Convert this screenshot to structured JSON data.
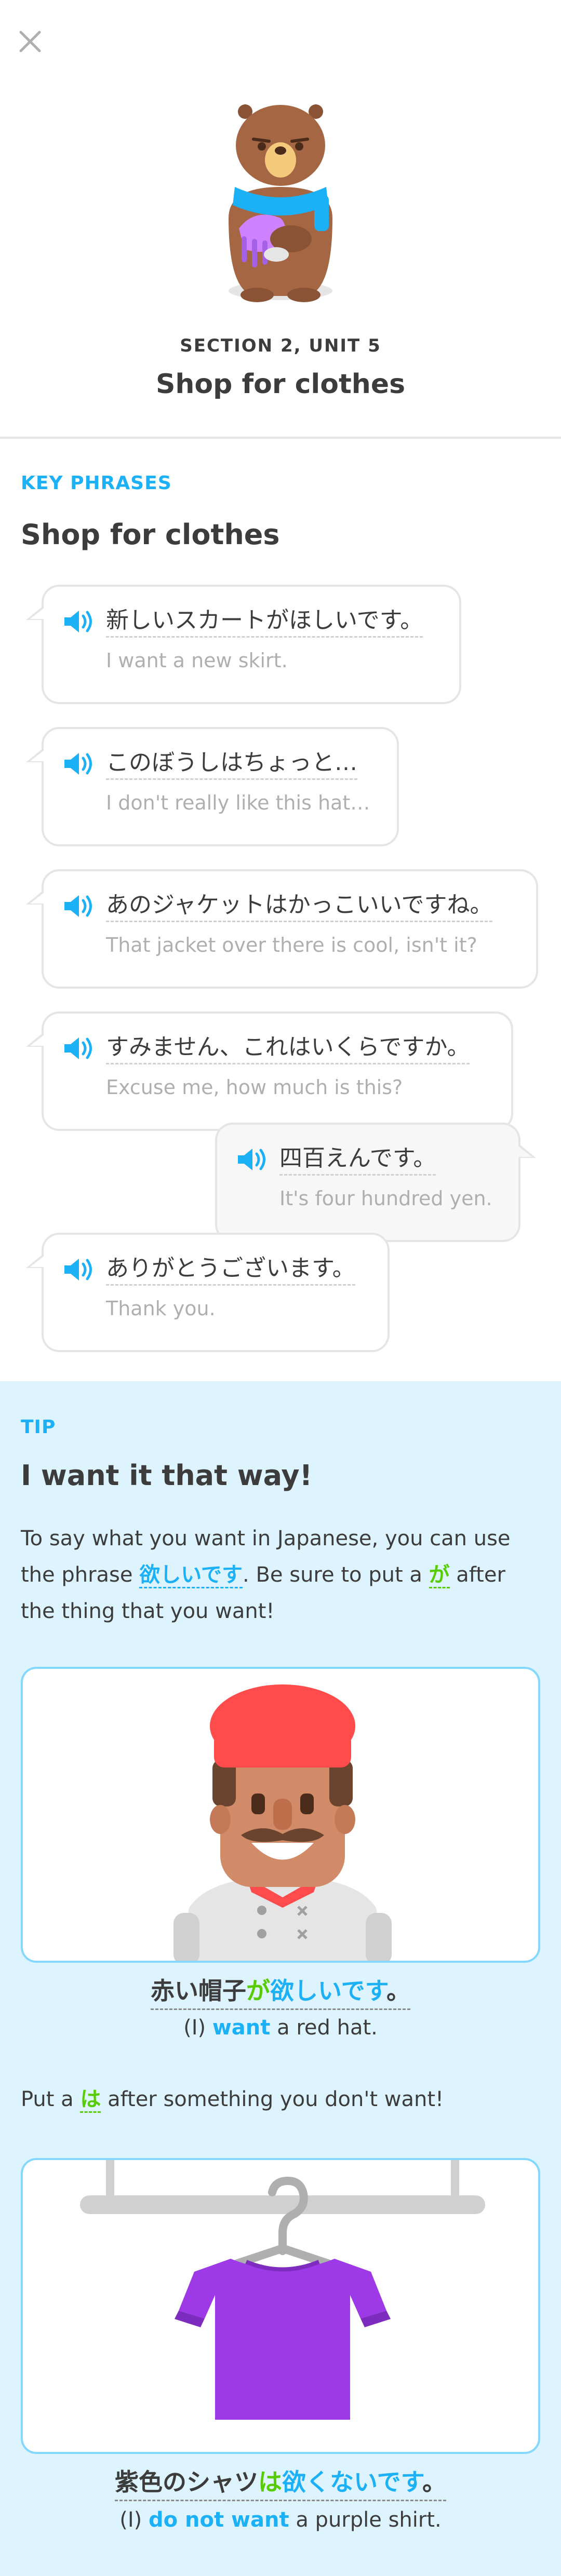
{
  "header": {
    "close_icon": "close-icon",
    "section_label": "SECTION 2, UNIT 5",
    "unit_title": "Shop for clothes",
    "mascot": "bear-character"
  },
  "key_phrases": {
    "label": "KEY PHRASES",
    "title": "Shop for clothes",
    "phrases": [
      {
        "jp": "新しいスカートがほしいです。",
        "en": "I want a new skirt.",
        "side": "left"
      },
      {
        "jp": "このぼうしはちょっと…",
        "en": "I don't really like this hat…",
        "side": "left"
      },
      {
        "jp": "あのジャケットはかっこいいですね。",
        "en": "That jacket over there is cool, isn't it?",
        "side": "left"
      },
      {
        "jp": "すみません、これはいくらですか。",
        "en": "Excuse me, how much is this?",
        "side": "left"
      },
      {
        "jp": "四百えんです。",
        "en": "It's four hundred yen.",
        "side": "right"
      },
      {
        "jp": "ありがとうございます。",
        "en": "Thank you.",
        "side": "left"
      }
    ]
  },
  "tip": {
    "label": "TIP",
    "title": "I want it that way!",
    "text_part1": "To say what you want in Japanese, you can use the phrase ",
    "text_hl1": "欲しいです",
    "text_part2": ". Be sure to put a ",
    "text_hl2": "が",
    "text_part3": " after the thing that you want!",
    "example1": {
      "jp_a": "赤い帽子",
      "jp_b": "が",
      "jp_c": "欲しいです",
      "jp_d": "。",
      "en_a": "(I) ",
      "en_b": "want",
      "en_c": " a red hat."
    },
    "text2_part1": "Put a ",
    "text2_hl": "は",
    "text2_part2": " after something you don't want!",
    "example2": {
      "jp_a": "紫色のシャツ",
      "jp_b": "は",
      "jp_c": "欲くないです",
      "jp_d": "。",
      "en_a": "(I) ",
      "en_b": "do not want",
      "en_c": " a purple shirt."
    }
  },
  "colors": {
    "accent_blue": "#1cb0f6",
    "accent_green": "#58cc02",
    "tip_background": "#ddf4ff",
    "card_border": "#84d8ff"
  }
}
